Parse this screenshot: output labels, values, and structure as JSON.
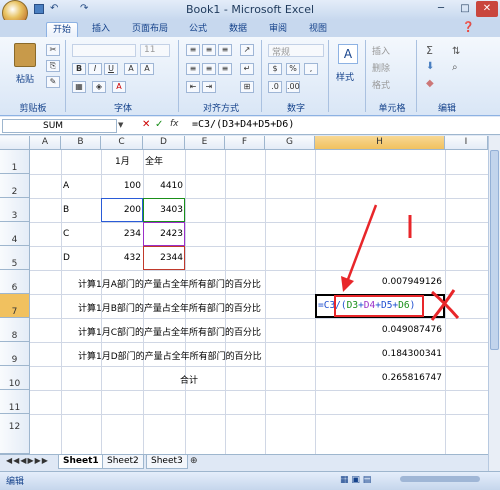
{
  "window": {
    "title": "Book1 - Microsoft Excel",
    "minimize": "─",
    "maximize": "□",
    "close": "✕"
  },
  "tabs": [
    "开始",
    "插入",
    "页面布局",
    "公式",
    "数据",
    "审阅",
    "视图"
  ],
  "ribbon": {
    "paste": "粘贴",
    "font_name": "",
    "font_size": "11",
    "number_format": "常规",
    "styles": "样式",
    "insert": "插入",
    "delete": "删除",
    "format": "格式",
    "groups": [
      "剪贴板",
      "字体",
      "对齐方式",
      "数字",
      "单元格",
      "编辑"
    ]
  },
  "formula_bar": {
    "name_box": "SUM",
    "fx": "fx",
    "formula": "=C3/(D3+D4+D5+D6)"
  },
  "columns": [
    "A",
    "B",
    "C",
    "D",
    "E",
    "F",
    "G",
    "H",
    "I"
  ],
  "rows": [
    "1",
    "2",
    "3",
    "4",
    "5",
    "6",
    "7",
    "8",
    "9",
    "10",
    "11",
    "12"
  ],
  "cells": {
    "C1": "1月",
    "D1": "全年",
    "B2": "A",
    "C2": "100",
    "D2": "4410",
    "B3": "B",
    "C3": "200",
    "D3": "3403",
    "B4": "C",
    "C4": "234",
    "D4": "2423",
    "B5": "D",
    "C5": "432",
    "D5": "2344",
    "B6": "计算1月A部门的产量占全年所有部门的百分比",
    "H6": "0.007949126",
    "B7": "计算1月B部门的产量占全年所有部门的百分比",
    "B8": "计算1月C部门的产量占全年所有部门的百分比",
    "H8": "0.049087476",
    "B9": "计算1月D部门的产量占全年所有部门的百分比",
    "H9": "0.184300341",
    "D10": "合计",
    "H10": "0.265816747"
  },
  "editing_cell": {
    "parts": [
      {
        "text": "=C3/(",
        "color": "#1f4fd0"
      },
      {
        "text": "D3",
        "color": "#1a8f1a"
      },
      {
        "text": "+",
        "color": "#1f4fd0"
      },
      {
        "text": "D4",
        "color": "#9b30c8"
      },
      {
        "text": "+D5+",
        "color": "#1f4fd0"
      },
      {
        "text": "D6",
        "color": "#1a8f1a"
      },
      {
        "text": ")",
        "color": "#1f4fd0"
      }
    ]
  },
  "sheets": [
    "Sheet1",
    "Sheet2",
    "Sheet3"
  ],
  "status": "编辑",
  "annotation_color": "#e8262a"
}
